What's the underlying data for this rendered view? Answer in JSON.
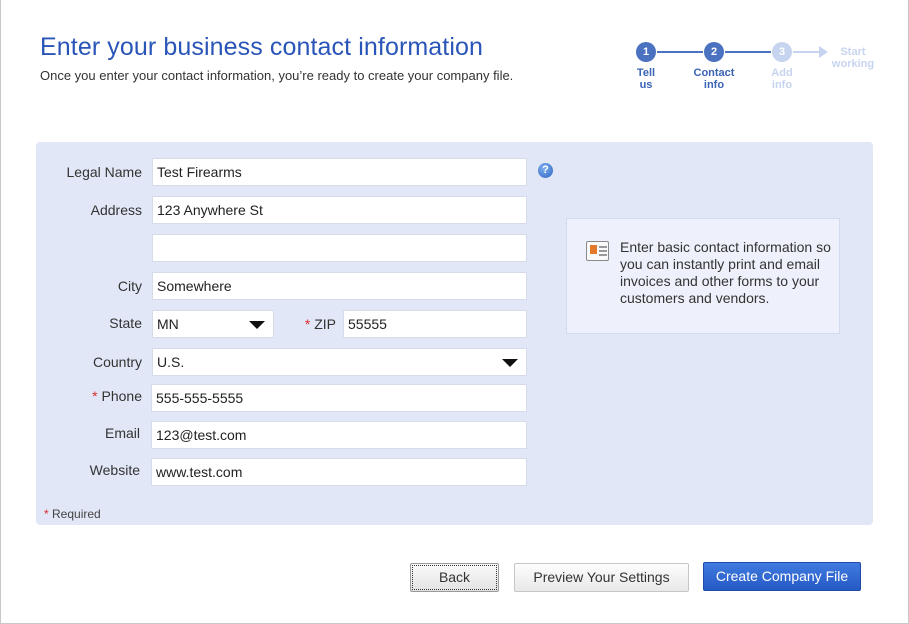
{
  "header": {
    "title": "Enter your business contact information",
    "subtitle": "Once you enter your contact information, you’re ready to create your company file."
  },
  "stepper": {
    "steps": [
      {
        "number": "1",
        "label_line1": "Tell",
        "label_line2": "us",
        "state": "done"
      },
      {
        "number": "2",
        "label_line1": "Contact",
        "label_line2": "info",
        "state": "active"
      },
      {
        "number": "3",
        "label_line1": "Add",
        "label_line2": "info",
        "state": "future"
      },
      {
        "number": "",
        "label_line1": "Start",
        "label_line2": "working",
        "state": "future"
      }
    ]
  },
  "form": {
    "legal_name_label": "Legal Name",
    "legal_name_value": "Test Firearms",
    "address_label": "Address",
    "address1_value": "123 Anywhere St",
    "address2_value": "",
    "city_label": "City",
    "city_value": "Somewhere",
    "state_label": "State",
    "state_value": "MN",
    "zip_label": "ZIP",
    "zip_value": "55555",
    "country_label": "Country",
    "country_value": "U.S.",
    "phone_label": "Phone",
    "phone_value": "555-555-5555",
    "email_label": "Email",
    "email_value": "123@test.com",
    "website_label": "Website",
    "website_value": "www.test.com",
    "required_mark": "*",
    "required_note": "Required",
    "help_glyph": "?"
  },
  "info": {
    "text": "Enter basic contact information so you can instantly print and email invoices and other forms to your customers and vendors.",
    "icon": "contact-card-icon"
  },
  "buttons": {
    "back": "Back",
    "preview": "Preview Your Settings",
    "create": "Create Company File"
  },
  "colors": {
    "accent": "#2a55b8",
    "panel": "#e1e7f6",
    "required": "#d92b2b",
    "primary_button": "#2659c4"
  }
}
